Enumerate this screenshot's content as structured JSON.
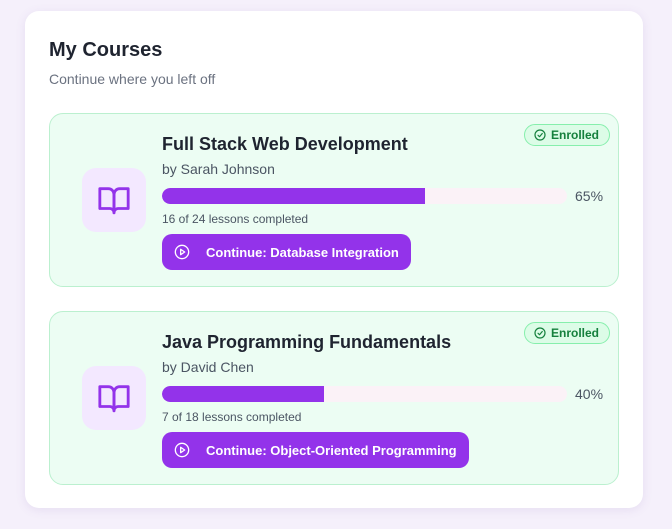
{
  "header": {
    "title": "My Courses",
    "subtitle": "Continue where you left off"
  },
  "colors": {
    "accent": "#9333ea",
    "card_bg": "#ecfdf3",
    "enrolled_green": "#15803d"
  },
  "courses": [
    {
      "title": "Full Stack Web Development",
      "author": "by Sarah Johnson",
      "progress": 65,
      "progress_label": "65%",
      "lessons": "16 of 24 lessons completed",
      "status": "Enrolled",
      "continue_label": "Continue: Database Integration",
      "icon": "book-open-icon"
    },
    {
      "title": "Java Programming Fundamentals",
      "author": "by David Chen",
      "progress": 40,
      "progress_label": "40%",
      "lessons": "7 of 18 lessons completed",
      "status": "Enrolled",
      "continue_label": "Continue: Object-Oriented Programming",
      "icon": "book-open-icon"
    }
  ]
}
